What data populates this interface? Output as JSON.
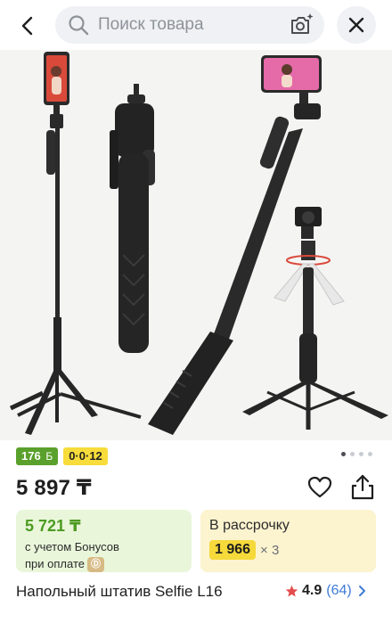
{
  "search": {
    "placeholder": "Поиск товара"
  },
  "icons": {
    "back": "chevron-left-icon",
    "search": "search-icon",
    "camera": "camera-search-icon",
    "close": "close-icon",
    "favorite": "heart-icon",
    "share": "share-icon",
    "rating": "star-icon"
  },
  "badges": {
    "bonus_value": "176",
    "bonus_currency": "Б",
    "installment": "0·0·12"
  },
  "gallery": {
    "total_images": 4,
    "active_index": 1
  },
  "price": {
    "current": "5 897 ₸"
  },
  "bonus_offer": {
    "price": "5 721 ₸",
    "note_line1": "с учетом Бонусов",
    "note_line2": "при оплате",
    "coin_symbol": "Ⓓ"
  },
  "installment_offer": {
    "title": "В рассрочку",
    "amount": "1 966",
    "multiplier": "× 3"
  },
  "product": {
    "title": "Напольный штатив Selfie L16",
    "rating": "4.9",
    "reviews": "(64)"
  },
  "colors": {
    "accent_green": "#4d9b22",
    "badge_green": "#5aa02c",
    "badge_yellow": "#f7dc3b",
    "link_blue": "#3f7bd6",
    "star_red": "#e34d4d"
  }
}
